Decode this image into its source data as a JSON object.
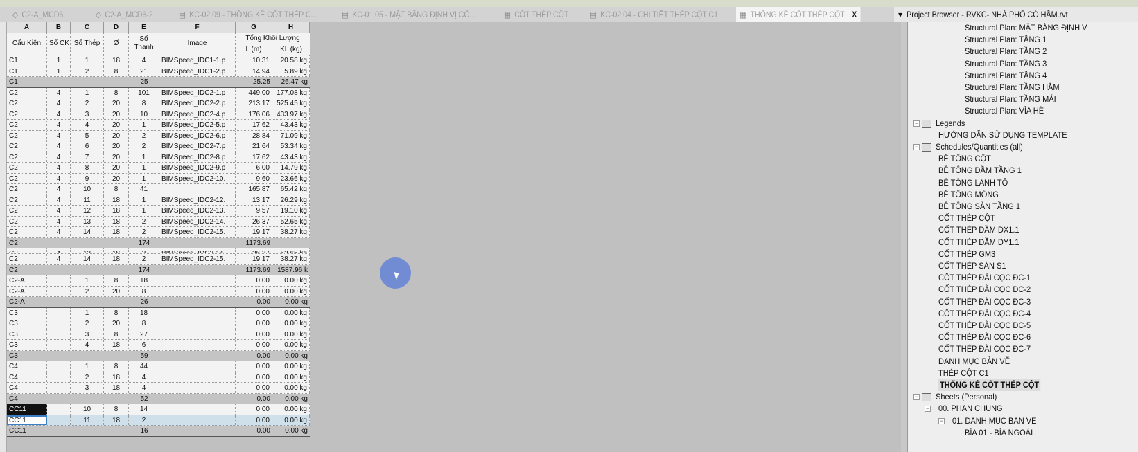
{
  "tabs": [
    {
      "label": "C2-A_MCD6",
      "icon": "3d-view-icon"
    },
    {
      "label": "C2-A_MCD6-2",
      "icon": "3d-view-icon"
    },
    {
      "label": "KC-02.09 - THỐNG KÊ CỐT THÉP C...",
      "icon": "sheet-icon"
    },
    {
      "label": "KC-01.05 - MẶT BẰNG ĐỊNH VỊ CỐ...",
      "icon": "sheet-icon"
    },
    {
      "label": "CỐT THÉP CỘT",
      "icon": "schedule-icon"
    },
    {
      "label": "KC-02.04 - CHI TIẾT THÉP CỘT C1",
      "icon": "sheet-icon"
    },
    {
      "label": "THỐNG KÊ CỐT THÉP CỘT",
      "icon": "schedule-icon",
      "active": true,
      "close": "X"
    }
  ],
  "schedule": {
    "letters": [
      "A",
      "B",
      "C",
      "D",
      "E",
      "F",
      "G",
      "H"
    ],
    "headers": {
      "a": "Cấu Kiện",
      "b": "Số CK",
      "c": "Số Thép",
      "d": "Ø",
      "e": "Số Thanh",
      "f": "Image",
      "group": "Tổng Khối Lượng",
      "g": "L (m)",
      "h": "KL (kg)"
    },
    "rows": [
      [
        "C1",
        "1",
        "1",
        "18",
        "4",
        "BIMSpeed_IDC1-1.p",
        "10.31",
        "20.58 kg",
        ""
      ],
      [
        "C1",
        "1",
        "2",
        "8",
        "21",
        "BIMSpeed_IDC1-2.p",
        "14.94",
        "5.89 kg",
        ""
      ],
      [
        "C1",
        "",
        "",
        "",
        "25",
        "",
        "25.25",
        "26.47 kg",
        "sum"
      ],
      [
        "C2",
        "4",
        "1",
        "8",
        "101",
        "BIMSpeed_IDC2-1.p",
        "449.00",
        "177.08 kg",
        ""
      ],
      [
        "C2",
        "4",
        "2",
        "20",
        "8",
        "BIMSpeed_IDC2-2.p",
        "213.17",
        "525.45 kg",
        ""
      ],
      [
        "C2",
        "4",
        "3",
        "20",
        "10",
        "BIMSpeed_IDC2-4.p",
        "176.06",
        "433.97 kg",
        ""
      ],
      [
        "C2",
        "4",
        "4",
        "20",
        "1",
        "BIMSpeed_IDC2-5.p",
        "17.62",
        "43.43 kg",
        ""
      ],
      [
        "C2",
        "4",
        "5",
        "20",
        "2",
        "BIMSpeed_IDC2-6.p",
        "28.84",
        "71.09 kg",
        ""
      ],
      [
        "C2",
        "4",
        "6",
        "20",
        "2",
        "BIMSpeed_IDC2-7.p",
        "21.64",
        "53.34 kg",
        ""
      ],
      [
        "C2",
        "4",
        "7",
        "20",
        "1",
        "BIMSpeed_IDC2-8.p",
        "17.62",
        "43.43 kg",
        ""
      ],
      [
        "C2",
        "4",
        "8",
        "20",
        "1",
        "BIMSpeed_IDC2-9.p",
        "6.00",
        "14.79 kg",
        ""
      ],
      [
        "C2",
        "4",
        "9",
        "20",
        "1",
        "BIMSpeed_IDC2-10.",
        "9.60",
        "23.66 kg",
        ""
      ],
      [
        "C2",
        "4",
        "10",
        "8",
        "41",
        "",
        "165.87",
        "65.42 kg",
        ""
      ],
      [
        "C2",
        "4",
        "11",
        "18",
        "1",
        "BIMSpeed_IDC2-12.",
        "13.17",
        "26.29 kg",
        ""
      ],
      [
        "C2",
        "4",
        "12",
        "18",
        "1",
        "BIMSpeed_IDC2-13.",
        "9.57",
        "19.10 kg",
        ""
      ],
      [
        "C2",
        "4",
        "13",
        "18",
        "2",
        "BIMSpeed_IDC2-14.",
        "26.37",
        "52.65 kg",
        ""
      ],
      [
        "C2",
        "4",
        "14",
        "18",
        "2",
        "BIMSpeed_IDC2-15.",
        "19.17",
        "38.27 kg",
        ""
      ],
      [
        "C2",
        "",
        "",
        "",
        "174",
        "",
        "1173.69",
        "",
        "sum"
      ],
      [
        "C2",
        "4",
        "13",
        "18",
        "2",
        "BIMSpeed_IDC2-14.",
        "26.37",
        "52.65 kg",
        "part"
      ],
      [
        "C2",
        "4",
        "14",
        "18",
        "2",
        "BIMSpeed_IDC2-15.",
        "19.17",
        "38.27 kg",
        ""
      ],
      [
        "C2",
        "",
        "",
        "",
        "174",
        "",
        "1173.69",
        "1587.96 k",
        "sum"
      ],
      [
        "C2-A",
        "",
        "1",
        "8",
        "18",
        "",
        "0.00",
        "0.00 kg",
        ""
      ],
      [
        "C2-A",
        "",
        "2",
        "20",
        "8",
        "",
        "0.00",
        "0.00 kg",
        ""
      ],
      [
        "C2-A",
        "",
        "",
        "",
        "26",
        "",
        "0.00",
        "0.00 kg",
        "sum"
      ],
      [
        "C3",
        "",
        "1",
        "8",
        "18",
        "",
        "0.00",
        "0.00 kg",
        ""
      ],
      [
        "C3",
        "",
        "2",
        "20",
        "8",
        "",
        "0.00",
        "0.00 kg",
        ""
      ],
      [
        "C3",
        "",
        "3",
        "8",
        "27",
        "",
        "0.00",
        "0.00 kg",
        ""
      ],
      [
        "C3",
        "",
        "4",
        "18",
        "6",
        "",
        "0.00",
        "0.00 kg",
        ""
      ],
      [
        "C3",
        "",
        "",
        "",
        "59",
        "",
        "0.00",
        "0.00 kg",
        "sum"
      ],
      [
        "C4",
        "",
        "1",
        "8",
        "44",
        "",
        "0.00",
        "0.00 kg",
        ""
      ],
      [
        "C4",
        "",
        "2",
        "18",
        "4",
        "",
        "0.00",
        "0.00 kg",
        ""
      ],
      [
        "C4",
        "",
        "3",
        "18",
        "4",
        "",
        "0.00",
        "0.00 kg",
        ""
      ],
      [
        "C4",
        "",
        "",
        "",
        "52",
        "",
        "0.00",
        "0.00 kg",
        "sum"
      ],
      [
        "CC11",
        "",
        "10",
        "8",
        "14",
        "",
        "0.00",
        "0.00 kg",
        "black"
      ],
      [
        "CC11",
        "",
        "11",
        "18",
        "2",
        "",
        "0.00",
        "0.00 kg",
        "sel"
      ],
      [
        "CC11",
        "",
        "",
        "",
        "16",
        "",
        "0.00",
        "0.00 kg",
        "sum"
      ]
    ]
  },
  "project_browser": {
    "title": "Project Browser - RVKC- NHÀ PHỐ CÓ HẦM.rvt",
    "items": [
      {
        "label": "Structural Plan: MẶT BẰNG ĐỊNH V",
        "level": 4
      },
      {
        "label": "Structural Plan: TẦNG 1",
        "level": 4
      },
      {
        "label": "Structural Plan: TẦNG 2",
        "level": 4
      },
      {
        "label": "Structural Plan: TẦNG 3",
        "level": 4
      },
      {
        "label": "Structural Plan: TẦNG 4",
        "level": 4
      },
      {
        "label": "Structural Plan: TẦNG HẦM",
        "level": 4
      },
      {
        "label": "Structural Plan: TẦNG MÁI",
        "level": 4
      },
      {
        "label": "Structural Plan: VỈA HÈ",
        "level": 4
      },
      {
        "label": "Legends",
        "level": 1,
        "icon": "legend-icon"
      },
      {
        "label": "HƯỚNG DẪN SỬ DỤNG TEMPLATE",
        "level": 2
      },
      {
        "label": "Schedules/Quantities (all)",
        "level": 1,
        "icon": "schedule-icon"
      },
      {
        "label": "BÊ TÔNG CỘT",
        "level": 2
      },
      {
        "label": "BÊ TÔNG DẦM TẦNG 1",
        "level": 2
      },
      {
        "label": "BÊ TÔNG LANH TÔ",
        "level": 2
      },
      {
        "label": "BÊ TÔNG MÓNG",
        "level": 2
      },
      {
        "label": "BÊ TÔNG SÀN TẦNG 1",
        "level": 2
      },
      {
        "label": "CỐT THÉP CỘT",
        "level": 2
      },
      {
        "label": "CỐT THÉP DẦM DX1.1",
        "level": 2
      },
      {
        "label": "CỐT THÉP DẦM DY1.1",
        "level": 2
      },
      {
        "label": "CỐT THÉP GM3",
        "level": 2
      },
      {
        "label": "CỐT THÉP SÀN S1",
        "level": 2
      },
      {
        "label": "CỐT THÉP ĐÀI CỌC ĐC-1",
        "level": 2
      },
      {
        "label": "CỐT THÉP ĐÀI CỌC ĐC-2",
        "level": 2
      },
      {
        "label": "CỐT THÉP ĐÀI CỌC ĐC-3",
        "level": 2
      },
      {
        "label": "CỐT THÉP ĐÀI CỌC ĐC-4",
        "level": 2
      },
      {
        "label": "CỐT THÉP ĐÀI CỌC ĐC-5",
        "level": 2
      },
      {
        "label": "CỐT THÉP ĐÀI CỌC ĐC-6",
        "level": 2
      },
      {
        "label": "CỐT THÉP ĐÀI CỌC ĐC-7",
        "level": 2
      },
      {
        "label": "DANH MỤC BẢN VẼ",
        "level": 2
      },
      {
        "label": "THÉP CỘT C1",
        "level": 2
      },
      {
        "label": "THỐNG KÊ CỐT THÉP CỘT",
        "level": 2,
        "selected": true
      },
      {
        "label": "Sheets (Personal)",
        "level": 1,
        "icon": "sheet-icon"
      },
      {
        "label": "00. PHAN CHUNG",
        "level": 2,
        "expand": true
      },
      {
        "label": "01. DANH MUC BAN VE",
        "level": 3,
        "expand": true
      },
      {
        "label": "BÌA 01 - BÌA NGOÀI",
        "level": 4
      }
    ]
  }
}
